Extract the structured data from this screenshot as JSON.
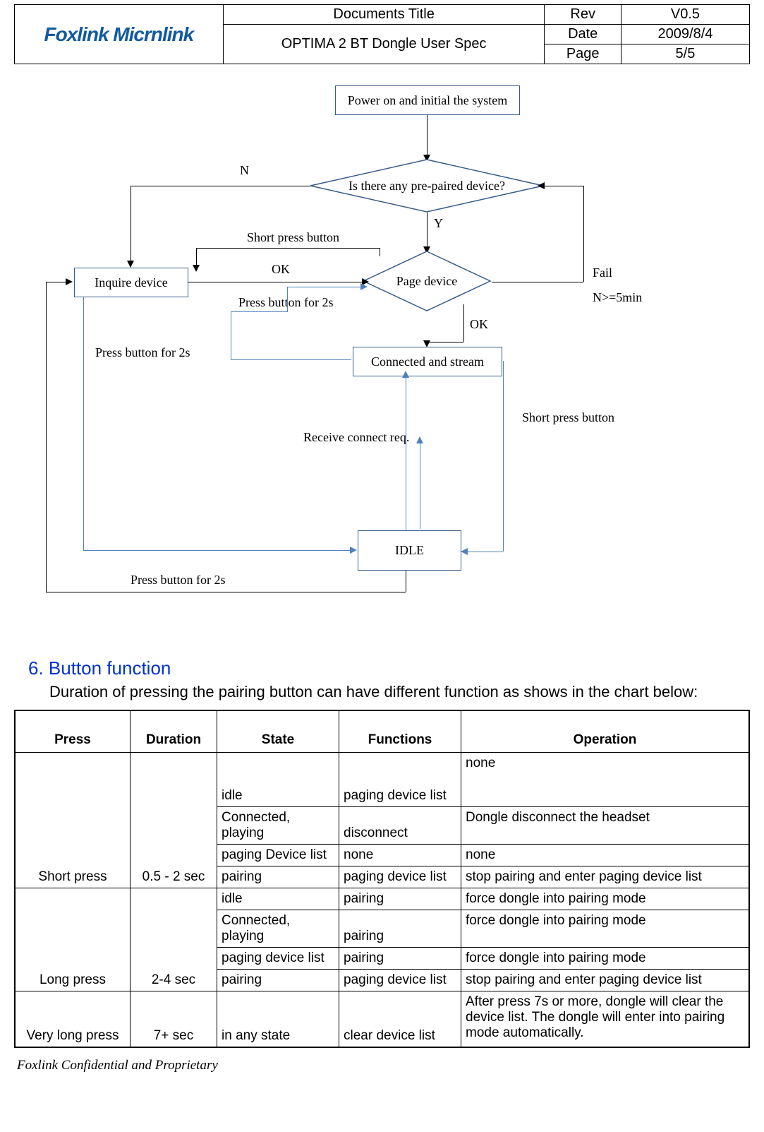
{
  "header": {
    "docTitleLabel": "Documents Title",
    "docTitle": "OPTIMA 2 BT Dongle User Spec",
    "revLabel": "Rev",
    "rev": "V0.5",
    "dateLabel": "Date",
    "date": "2009/8/4",
    "pageLabel": "Page",
    "page": "5/5",
    "logo": "Foxlink Micrnlink"
  },
  "flow": {
    "start": "Power on and initial the system",
    "decision": "Is there any pre-paired device?",
    "inquire": "Inquire device",
    "page": "Page device",
    "connected": "Connected and stream",
    "receive": "Receive connect req.",
    "idle": "IDLE",
    "n": "N",
    "y": "Y",
    "ok1": "OK",
    "ok2": "OK",
    "fail": "Fail",
    "failCond": "N>=5min",
    "shortPress": "Short press button",
    "shortPress2": "Short press button",
    "press2s_a": "Press button for 2s",
    "press2s_b": "Press button for 2s",
    "press2s_c": "Press button for 2s"
  },
  "section": {
    "heading": "6. Button function",
    "intro": "Duration of pressing the pairing button can have different function as shows in the chart below:"
  },
  "table": {
    "headers": {
      "press": "Press",
      "duration": "Duration",
      "state": "State",
      "functions": "Functions",
      "operation": "Operation"
    },
    "groups": [
      {
        "press": "Short press",
        "duration": "0.5 - 2 sec",
        "rows": [
          {
            "state": "idle",
            "func": "paging device list",
            "op": "none"
          },
          {
            "state": "Connected, playing",
            "func": "disconnect",
            "op": "Dongle disconnect the headset"
          },
          {
            "state": "paging Device list",
            "func": "none",
            "op": "none"
          },
          {
            "state": "pairing",
            "func": "paging device list",
            "op": "stop pairing and enter paging device list"
          }
        ]
      },
      {
        "press": "Long press",
        "duration": "2-4 sec",
        "rows": [
          {
            "state": "idle",
            "func": "pairing",
            "op": "force dongle into pairing mode"
          },
          {
            "state": "Connected, playing",
            "func": "pairing",
            "op": "force dongle into pairing mode"
          },
          {
            "state": "paging device list",
            "func": "pairing",
            "op": "force dongle into pairing mode"
          },
          {
            "state": "pairing",
            "func": "paging device list",
            "op": "stop pairing and enter paging device list"
          }
        ]
      },
      {
        "press": "Very long press",
        "duration": "7+ sec",
        "rows": [
          {
            "state": "in any state",
            "func": "clear device list",
            "op": "After press 7s or more, dongle will clear the device list. The dongle will enter into pairing mode automatically."
          }
        ]
      }
    ]
  },
  "footer": "Foxlink Confidential and Proprietary"
}
